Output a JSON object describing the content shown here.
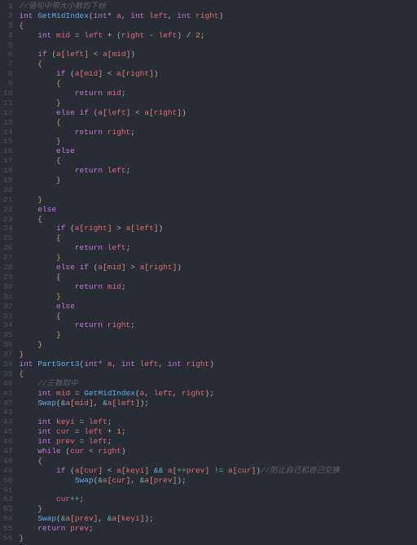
{
  "file_language": "c",
  "function1": {
    "comment": "//语句中带大小数的下标",
    "signature": [
      "int",
      "GetMidIndex",
      "int*",
      "a",
      "int",
      "left",
      "int",
      "right"
    ],
    "mid_assign": [
      "int",
      "mid",
      "=",
      "left",
      "+",
      "(",
      "right",
      "-",
      "left",
      ")",
      "/",
      "2",
      ";"
    ]
  },
  "function2": {
    "signature": [
      "int",
      "PartSort3",
      "int*",
      "a",
      "int",
      "left",
      "int",
      "right"
    ],
    "comment": "//三数取中",
    "decl": [
      "int",
      "mid",
      "=",
      "GetMidIndex",
      "(",
      "a",
      ",",
      "left",
      ",",
      "right",
      ")"
    ],
    "swap1": [
      "Swap",
      "&a[mid]",
      "&a[left]"
    ],
    "keyi": [
      "int",
      "keyi",
      "=",
      "left",
      ";"
    ],
    "cur": [
      "int",
      "cur",
      "=",
      "left",
      "+",
      "1",
      ";"
    ],
    "prev": [
      "int",
      "prev",
      "=",
      "left",
      ";"
    ],
    "while": [
      "while",
      "(",
      "cur",
      "<",
      "right",
      ")"
    ],
    "if_cmt": "//防止自己和自己交换",
    "swap2": [
      "Swap",
      "&a[cur]",
      "&a[prev]"
    ],
    "swap3": [
      "Swap",
      "&a[prev]",
      "&a[keyi]"
    ],
    "ret": [
      "return",
      "prev",
      ";"
    ]
  },
  "lines_comment": {
    "1": "//语句中带大小数的下标",
    "40": "//三数取中",
    "49_tail": "//防止自己和自己交换"
  },
  "raw_lines": [
    "//语句中带大小数的下标",
    "int GetMidIndex(int* a, int left, int right)",
    "{",
    "    int mid = left + (right - left) / 2;",
    "",
    "    if (a[left] < a[mid])",
    "    {",
    "        if (a[mid] < a[right])",
    "        {",
    "            return mid;",
    "        }",
    "        else if (a[left] < a[right])",
    "        {",
    "            return right;",
    "        }",
    "        else",
    "        {",
    "            return left;",
    "        }",
    "",
    "    }",
    "    else",
    "    {",
    "        if (a[right] > a[left])",
    "        {",
    "            return left;",
    "        }",
    "        else if (a[mid] > a[right])",
    "        {",
    "            return mid;",
    "        }",
    "        else",
    "        {",
    "            return right;",
    "        }",
    "    }",
    "}",
    "int PartSort3(int* a, int left, int right)",
    "{",
    "    //三数取中",
    "    int mid = GetMidIndex(a, left, right);",
    "    Swap(&a[mid], &a[left]);",
    "",
    "    int keyi = left;",
    "    int cur = left + 1;",
    "    int prev = left;",
    "    while (cur < right)",
    "    {",
    "        if (a[cur] < a[keyi] && a[++prev] != a[cur])//防止自己和自己交换",
    "            Swap(&a[cur], &a[prev]);",
    "",
    "        cur++;",
    "    }",
    "    Swap(&a[prev], &a[keyi]);",
    "    return prev;",
    "}"
  ],
  "line_count": 56
}
